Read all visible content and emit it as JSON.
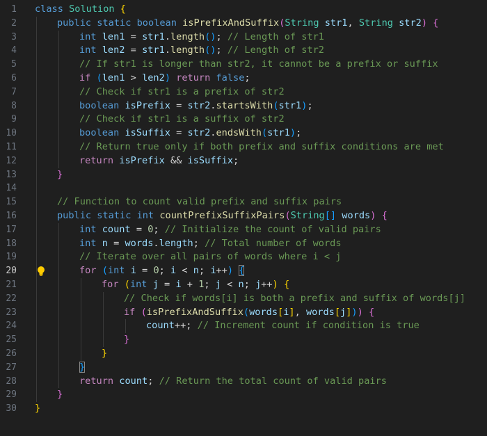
{
  "editor": {
    "language": "java",
    "active_line": 20,
    "lines": [
      {
        "n": "1",
        "indent": 0,
        "tokens": [
          [
            "kw",
            "class "
          ],
          [
            "ty",
            "Solution "
          ],
          [
            "b1",
            "{"
          ]
        ]
      },
      {
        "n": "2",
        "indent": 1,
        "tokens": [
          [
            "kw",
            "public "
          ],
          [
            "kw",
            "static "
          ],
          [
            "kw",
            "boolean "
          ],
          [
            "fn",
            "isPrefixAndSuffix"
          ],
          [
            "b2",
            "("
          ],
          [
            "ty",
            "String "
          ],
          [
            "var",
            "str1"
          ],
          [
            "pl",
            ", "
          ],
          [
            "ty",
            "String "
          ],
          [
            "var",
            "str2"
          ],
          [
            "b2",
            ")"
          ],
          [
            "pl",
            " "
          ],
          [
            "b2",
            "{"
          ]
        ]
      },
      {
        "n": "3",
        "indent": 2,
        "tokens": [
          [
            "kw",
            "int "
          ],
          [
            "var",
            "len1"
          ],
          [
            "pl",
            " = "
          ],
          [
            "var",
            "str1"
          ],
          [
            "pl",
            "."
          ],
          [
            "fn",
            "length"
          ],
          [
            "b3",
            "()"
          ],
          [
            "pl",
            "; "
          ],
          [
            "cm",
            "// Length of str1"
          ]
        ]
      },
      {
        "n": "4",
        "indent": 2,
        "tokens": [
          [
            "kw",
            "int "
          ],
          [
            "var",
            "len2"
          ],
          [
            "pl",
            " = "
          ],
          [
            "var",
            "str1"
          ],
          [
            "pl",
            "."
          ],
          [
            "fn",
            "length"
          ],
          [
            "b3",
            "()"
          ],
          [
            "pl",
            "; "
          ],
          [
            "cm",
            "// Length of str2"
          ]
        ]
      },
      {
        "n": "5",
        "indent": 2,
        "tokens": [
          [
            "cm",
            "// If str1 is longer than str2, it cannot be a prefix or suffix"
          ]
        ]
      },
      {
        "n": "6",
        "indent": 2,
        "tokens": [
          [
            "kwc",
            "if "
          ],
          [
            "b3",
            "("
          ],
          [
            "var",
            "len1"
          ],
          [
            "pl",
            " > "
          ],
          [
            "var",
            "len2"
          ],
          [
            "b3",
            ")"
          ],
          [
            "pl",
            " "
          ],
          [
            "kwc",
            "return "
          ],
          [
            "kw",
            "false"
          ],
          [
            "pl",
            ";"
          ]
        ]
      },
      {
        "n": "7",
        "indent": 2,
        "tokens": [
          [
            "cm",
            "// Check if str1 is a prefix of str2"
          ]
        ]
      },
      {
        "n": "8",
        "indent": 2,
        "tokens": [
          [
            "kw",
            "boolean "
          ],
          [
            "var",
            "isPrefix"
          ],
          [
            "pl",
            " = "
          ],
          [
            "var",
            "str2"
          ],
          [
            "pl",
            "."
          ],
          [
            "fn",
            "startsWith"
          ],
          [
            "b3",
            "("
          ],
          [
            "var",
            "str1"
          ],
          [
            "b3",
            ")"
          ],
          [
            "pl",
            ";"
          ]
        ]
      },
      {
        "n": "9",
        "indent": 2,
        "tokens": [
          [
            "cm",
            "// Check if str1 is a suffix of str2"
          ]
        ]
      },
      {
        "n": "10",
        "indent": 2,
        "tokens": [
          [
            "kw",
            "boolean "
          ],
          [
            "var",
            "isSuffix"
          ],
          [
            "pl",
            " = "
          ],
          [
            "var",
            "str2"
          ],
          [
            "pl",
            "."
          ],
          [
            "fn",
            "endsWith"
          ],
          [
            "b3",
            "("
          ],
          [
            "var",
            "str1"
          ],
          [
            "b3",
            ")"
          ],
          [
            "pl",
            ";"
          ]
        ]
      },
      {
        "n": "11",
        "indent": 2,
        "tokens": [
          [
            "cm",
            "// Return true only if both prefix and suffix conditions are met"
          ]
        ]
      },
      {
        "n": "12",
        "indent": 2,
        "tokens": [
          [
            "kwc",
            "return "
          ],
          [
            "var",
            "isPrefix"
          ],
          [
            "pl",
            " && "
          ],
          [
            "var",
            "isSuffix"
          ],
          [
            "pl",
            ";"
          ]
        ]
      },
      {
        "n": "13",
        "indent": 1,
        "tokens": [
          [
            "b2",
            "}"
          ]
        ]
      },
      {
        "n": "14",
        "indent": 1,
        "tokens": []
      },
      {
        "n": "15",
        "indent": 1,
        "tokens": [
          [
            "cm",
            "// Function to count valid prefix and suffix pairs"
          ]
        ]
      },
      {
        "n": "16",
        "indent": 1,
        "tokens": [
          [
            "kw",
            "public "
          ],
          [
            "kw",
            "static "
          ],
          [
            "kw",
            "int "
          ],
          [
            "fn",
            "countPrefixSuffixPairs"
          ],
          [
            "b2",
            "("
          ],
          [
            "ty",
            "String"
          ],
          [
            "b3",
            "[]"
          ],
          [
            "pl",
            " "
          ],
          [
            "var",
            "words"
          ],
          [
            "b2",
            ")"
          ],
          [
            "pl",
            " "
          ],
          [
            "b2",
            "{"
          ]
        ]
      },
      {
        "n": "17",
        "indent": 2,
        "tokens": [
          [
            "kw",
            "int "
          ],
          [
            "var",
            "count"
          ],
          [
            "pl",
            " = "
          ],
          [
            "num",
            "0"
          ],
          [
            "pl",
            "; "
          ],
          [
            "cm",
            "// Initialize the count of valid pairs"
          ]
        ]
      },
      {
        "n": "18",
        "indent": 2,
        "tokens": [
          [
            "kw",
            "int "
          ],
          [
            "var",
            "n"
          ],
          [
            "pl",
            " = "
          ],
          [
            "var",
            "words"
          ],
          [
            "pl",
            "."
          ],
          [
            "var",
            "length"
          ],
          [
            "pl",
            "; "
          ],
          [
            "cm",
            "// Total number of words"
          ]
        ]
      },
      {
        "n": "19",
        "indent": 2,
        "tokens": [
          [
            "cm",
            "// Iterate over all pairs of words where i < j"
          ]
        ]
      },
      {
        "n": "20",
        "indent": 2,
        "tokens": [
          [
            "kwc",
            "for "
          ],
          [
            "b3",
            "("
          ],
          [
            "kw",
            "int "
          ],
          [
            "var",
            "i"
          ],
          [
            "pl",
            " = "
          ],
          [
            "num",
            "0"
          ],
          [
            "pl",
            "; "
          ],
          [
            "var",
            "i"
          ],
          [
            "pl",
            " < "
          ],
          [
            "var",
            "n"
          ],
          [
            "pl",
            "; "
          ],
          [
            "var",
            "i"
          ],
          [
            "pl",
            "++"
          ],
          [
            "b3",
            ")"
          ],
          [
            "pl",
            " "
          ],
          [
            "b3box",
            "{"
          ]
        ]
      },
      {
        "n": "21",
        "indent": 3,
        "tokens": [
          [
            "kwc",
            "for "
          ],
          [
            "b1",
            "("
          ],
          [
            "kw",
            "int "
          ],
          [
            "var",
            "j"
          ],
          [
            "pl",
            " = "
          ],
          [
            "var",
            "i"
          ],
          [
            "pl",
            " + "
          ],
          [
            "num",
            "1"
          ],
          [
            "pl",
            "; "
          ],
          [
            "var",
            "j"
          ],
          [
            "pl",
            " < "
          ],
          [
            "var",
            "n"
          ],
          [
            "pl",
            "; "
          ],
          [
            "var",
            "j"
          ],
          [
            "pl",
            "++"
          ],
          [
            "b1",
            ")"
          ],
          [
            "pl",
            " "
          ],
          [
            "b1",
            "{"
          ]
        ]
      },
      {
        "n": "22",
        "indent": 4,
        "tokens": [
          [
            "cm",
            "// Check if words[i] is both a prefix and suffix of words[j]"
          ]
        ]
      },
      {
        "n": "23",
        "indent": 4,
        "tokens": [
          [
            "kwc",
            "if "
          ],
          [
            "b2",
            "("
          ],
          [
            "fn",
            "isPrefixAndSuffix"
          ],
          [
            "b3",
            "("
          ],
          [
            "var",
            "words"
          ],
          [
            "b1",
            "["
          ],
          [
            "var",
            "i"
          ],
          [
            "b1",
            "]"
          ],
          [
            "pl",
            ", "
          ],
          [
            "var",
            "words"
          ],
          [
            "b1",
            "["
          ],
          [
            "var",
            "j"
          ],
          [
            "b1",
            "]"
          ],
          [
            "b3",
            ")"
          ],
          [
            "b2",
            ")"
          ],
          [
            "pl",
            " "
          ],
          [
            "b2",
            "{"
          ]
        ]
      },
      {
        "n": "24",
        "indent": 5,
        "tokens": [
          [
            "var",
            "count"
          ],
          [
            "pl",
            "++; "
          ],
          [
            "cm",
            "// Increment count if condition is true"
          ]
        ]
      },
      {
        "n": "25",
        "indent": 4,
        "tokens": [
          [
            "b2",
            "}"
          ]
        ]
      },
      {
        "n": "26",
        "indent": 3,
        "tokens": [
          [
            "b1",
            "}"
          ]
        ]
      },
      {
        "n": "27",
        "indent": 2,
        "tokens": [
          [
            "b3box",
            "}"
          ]
        ]
      },
      {
        "n": "28",
        "indent": 2,
        "tokens": [
          [
            "kwc",
            "return "
          ],
          [
            "var",
            "count"
          ],
          [
            "pl",
            "; "
          ],
          [
            "cm",
            "// Return the total count of valid pairs"
          ]
        ]
      },
      {
        "n": "29",
        "indent": 1,
        "tokens": [
          [
            "b2",
            "}"
          ]
        ]
      },
      {
        "n": "30",
        "indent": 0,
        "tokens": [
          [
            "b1",
            "}"
          ]
        ]
      }
    ]
  },
  "icons": {
    "lightbulb": "lightbulb-icon"
  },
  "colors": {
    "background": "#1f1f1f",
    "keyword": "#569cd6",
    "control": "#c586c0",
    "type": "#4ec9b0",
    "function": "#dcdcaa",
    "variable": "#9cdcfe",
    "number": "#b5cea8",
    "comment": "#6a9955"
  }
}
